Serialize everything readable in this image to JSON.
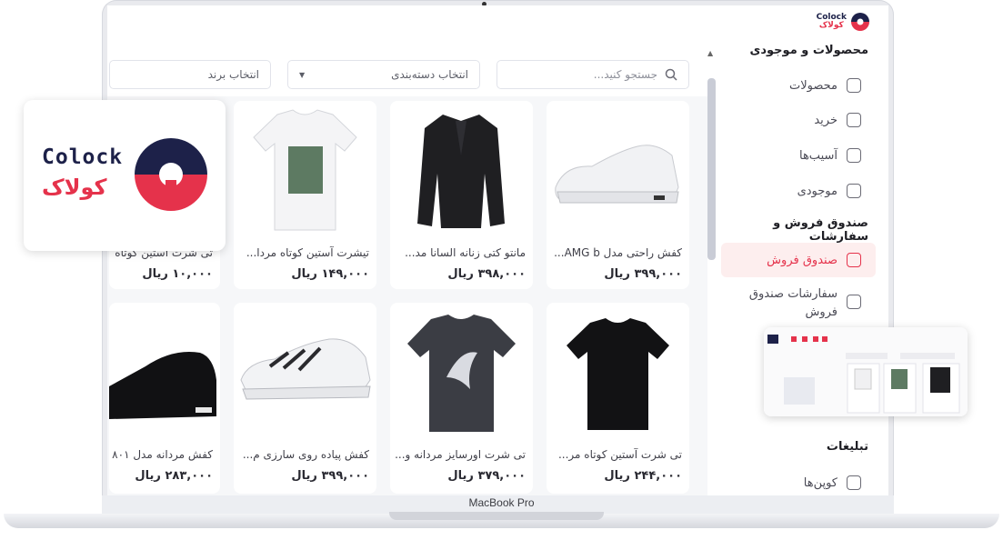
{
  "device": {
    "label": "MacBook Pro"
  },
  "brand": {
    "name_en": "Colock",
    "name_fa": "کولاک",
    "colors": {
      "navy": "#1d2149",
      "red": "#e5324b"
    }
  },
  "sidebar": {
    "section1": "محصولات و موجودی",
    "items1": [
      {
        "label": "محصولات",
        "icon": "box-icon"
      },
      {
        "label": "خرید",
        "icon": "cart-icon"
      },
      {
        "label": "آسیب‌ها",
        "icon": "puzzle-icon"
      },
      {
        "label": "موجودی",
        "icon": "package-icon"
      }
    ],
    "section2": "صندوق فروش و سفارشات",
    "items2": [
      {
        "label": "صندوق فروش",
        "icon": "receipt-icon",
        "active": true
      },
      {
        "label_line1": "سفارشات صندوق",
        "label_line2": "فروش",
        "icon": "orders-icon"
      }
    ],
    "section3": "تبلیغات",
    "items3": [
      {
        "label": "کوپن‌ها",
        "icon": "ticket-icon"
      }
    ]
  },
  "filters": {
    "search_placeholder": "جستجو کنید...",
    "category": "انتخاب دسته‌بندی",
    "brand": "انتخاب برند"
  },
  "products": [
    {
      "name": "کفش راحتی مدل AMG b...",
      "price": "۳۹۹,۰۰۰ ریال"
    },
    {
      "name": "مانتو کتی زنانه السانا مد...",
      "price": "۳۹۸,۰۰۰ ریال"
    },
    {
      "name": "تیشرت آستین کوتاه مردا...",
      "price": "۱۴۹,۰۰۰ ریال"
    },
    {
      "name": "تی شرت آستین کوتاه",
      "price": "۱۰,۰۰۰ ریال"
    },
    {
      "name": "تی شرت آستین کوتاه مر...",
      "price": "۲۴۴,۰۰۰ ریال"
    },
    {
      "name": "تی شرت اورسایز مردانه و...",
      "price": "۳۷۹,۰۰۰ ریال"
    },
    {
      "name": "کفش پیاده روی سارزی م...",
      "price": "۳۹۹,۰۰۰ ریال"
    },
    {
      "name": "کفش مردانه مدل ۸۰۱",
      "price": "۲۸۳,۰۰۰ ریال"
    }
  ]
}
